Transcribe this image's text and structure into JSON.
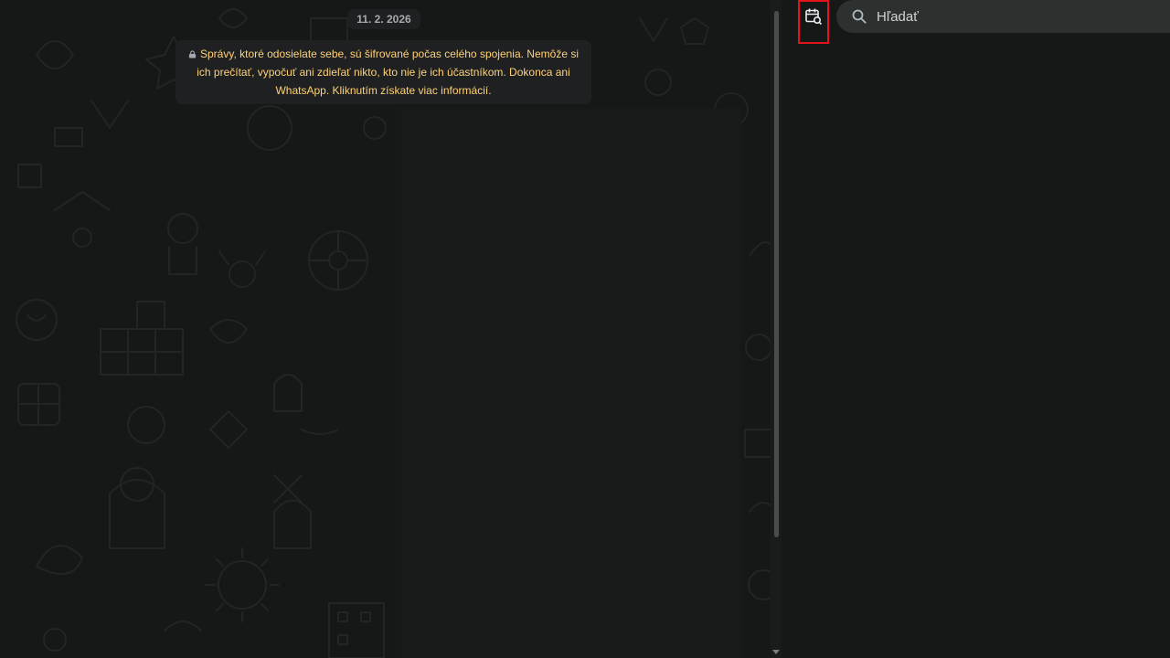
{
  "chat": {
    "date_chip": "11. 2. 2026",
    "encryption_notice": "Správy, ktoré odosielate sebe, sú šifrované počas celého spojenia. Nemôže si ich prečítať, vypočuť ani zdieľať nikto, kto nie je ich účastníkom. Dokonca ani WhatsApp. Kliknutím získate viac informácií."
  },
  "search_panel": {
    "search_placeholder": "Hľadať",
    "search_value": "",
    "date_search_icon": "calendar-search-icon",
    "search_icon": "search-icon"
  },
  "colors": {
    "background": "#161717",
    "notice_text": "#ffd279",
    "chip_background": "#1f2021",
    "search_background": "#2e2f2f",
    "highlight_border": "#e1141b"
  }
}
